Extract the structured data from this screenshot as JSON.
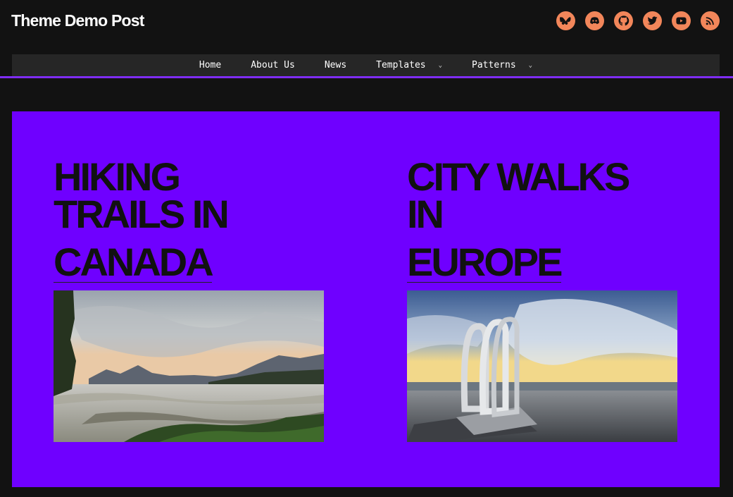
{
  "site": {
    "title": "Theme Demo Post"
  },
  "social": [
    {
      "name": "bluesky-icon"
    },
    {
      "name": "discord-icon"
    },
    {
      "name": "github-icon"
    },
    {
      "name": "twitter-icon"
    },
    {
      "name": "youtube-icon"
    },
    {
      "name": "rss-icon"
    }
  ],
  "colors": {
    "accent": "#6f00ff",
    "nav_line": "#7f2df5",
    "icon_bg": "#f2865a",
    "background": "#121212"
  },
  "nav": {
    "items": [
      {
        "label": "Home"
      },
      {
        "label": "About Us"
      },
      {
        "label": "News"
      },
      {
        "label": "Templates",
        "has_submenu": true
      },
      {
        "label": "Patterns",
        "has_submenu": true
      }
    ]
  },
  "posts": [
    {
      "title_line1": "Hiking",
      "title_line2": "Trails in",
      "title_line3": "Canada"
    },
    {
      "title_line1": "City Walks",
      "title_line2": "In",
      "title_line3": "Europe"
    }
  ]
}
